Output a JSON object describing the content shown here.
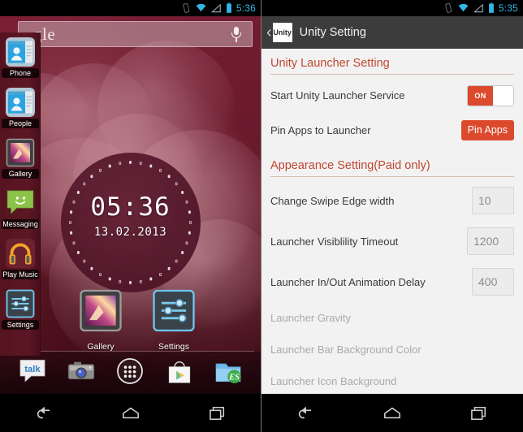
{
  "left_screen": {
    "statusbar": {
      "time": "5:36",
      "icons": [
        "vibrate-icon",
        "wifi-icon",
        "signal-icon",
        "battery-icon"
      ]
    },
    "search_widget": {
      "logo_text": "gle",
      "mic_icon": "microphone-icon"
    },
    "clock_widget": {
      "time": "05:36",
      "date": "13.02.2013"
    },
    "launcher": {
      "items": [
        {
          "label": "Phone",
          "icon": "phone-contact-icon"
        },
        {
          "label": "People",
          "icon": "people-contact-icon"
        },
        {
          "label": "Gallery",
          "icon": "gallery-icon"
        },
        {
          "label": "Messaging",
          "icon": "messaging-icon"
        },
        {
          "label": "Play Music",
          "icon": "play-music-icon"
        },
        {
          "label": "Settings",
          "icon": "settings-sliders-icon"
        }
      ]
    },
    "shortcuts": [
      {
        "label": "Gallery",
        "icon": "gallery-icon"
      },
      {
        "label": "Settings",
        "icon": "settings-sliders-icon"
      }
    ],
    "dock": [
      {
        "name": "talk",
        "icon": "google-talk-icon"
      },
      {
        "name": "Camera",
        "icon": "camera-icon"
      },
      {
        "name": "Apps",
        "icon": "app-drawer-icon"
      },
      {
        "name": "Play Store",
        "icon": "play-store-icon"
      },
      {
        "name": "ES File Explorer",
        "icon": "es-file-explorer-icon"
      }
    ],
    "navbar": [
      {
        "name": "Back",
        "icon": "back-icon"
      },
      {
        "name": "Home",
        "icon": "home-icon"
      },
      {
        "name": "Recents",
        "icon": "recents-icon"
      }
    ]
  },
  "right_screen": {
    "statusbar": {
      "time": "5:35",
      "icons": [
        "vibrate-icon",
        "wifi-icon",
        "signal-icon",
        "battery-icon"
      ]
    },
    "appbar": {
      "back_icon": "back-chevron-icon",
      "app_icon_label": "Unity",
      "title": "Unity Setting"
    },
    "sections": [
      {
        "heading": "Unity Launcher Setting",
        "rows": [
          {
            "label": "Start Unity Launcher Service",
            "control": "toggle",
            "value": "ON",
            "disabled": false
          },
          {
            "label": "Pin Apps to Launcher",
            "control": "button",
            "value": "Pin Apps",
            "disabled": false
          }
        ]
      },
      {
        "heading": "Appearance Setting(Paid only)",
        "rows": [
          {
            "label": "Change Swipe Edge width",
            "control": "number",
            "value": "10",
            "disabled": false
          },
          {
            "label": "Launcher Visiblility Timeout",
            "control": "number",
            "value": "1200",
            "disabled": false
          },
          {
            "label": "Launcher In/Out Animation Delay",
            "control": "number",
            "value": "400",
            "disabled": false
          },
          {
            "label": "Launcher Gravity",
            "control": "none",
            "value": "",
            "disabled": true
          },
          {
            "label": "Launcher Bar Background Color",
            "control": "none",
            "value": "",
            "disabled": true
          },
          {
            "label": "Launcher Icon Background",
            "control": "none",
            "value": "",
            "disabled": true
          }
        ]
      }
    ],
    "navbar": [
      {
        "name": "Back",
        "icon": "back-icon"
      },
      {
        "name": "Home",
        "icon": "home-icon"
      },
      {
        "name": "Recents",
        "icon": "recents-icon"
      }
    ]
  },
  "colors": {
    "accent_red": "#dc4a2e",
    "heading_red": "#c0462f",
    "status_blue": "#33b5e5",
    "settings_bg": "#f2f2f2",
    "appbar_bg": "#3c3c3c",
    "launcher_bar": "#5d1724"
  }
}
